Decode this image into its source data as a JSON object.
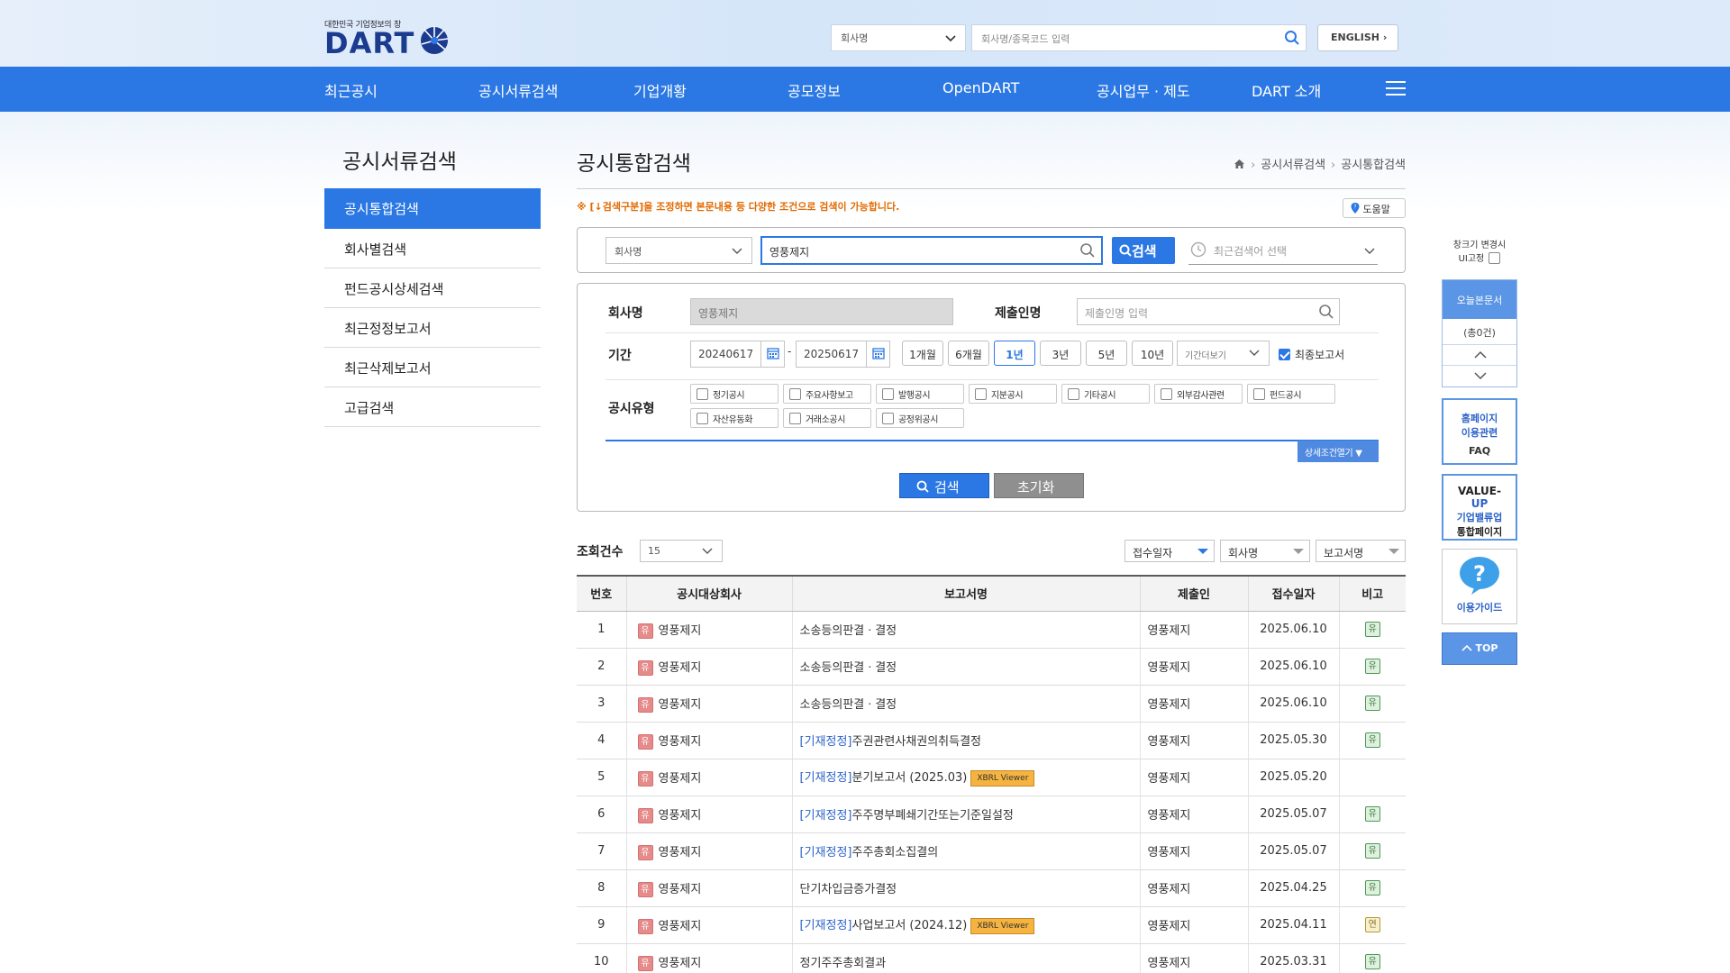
{
  "header": {
    "logo_subtitle": "대한민국 기업정보의 창",
    "logo_text": "DART",
    "search_type": "회사명",
    "search_placeholder": "회사명/종목코드 입력",
    "english_label": "ENGLISH"
  },
  "gnb": {
    "items": [
      "최근공시",
      "공시서류검색",
      "기업개황",
      "공모정보",
      "OpenDART",
      "공시업무 · 제도",
      "DART 소개"
    ]
  },
  "sidebar": {
    "title": "공시서류검색",
    "items": [
      {
        "label": "공시통합검색",
        "active": true
      },
      {
        "label": "회사별검색"
      },
      {
        "label": "펀드공시상세검색"
      },
      {
        "label": "최근정정보고서"
      },
      {
        "label": "최근삭제보고서"
      },
      {
        "label": "고급검색"
      }
    ]
  },
  "main": {
    "title": "공시통합검색",
    "breadcrumb": [
      "공시서류검색",
      "공시통합검색"
    ],
    "notice": "※ [↓검색구분]을 조정하면 본문내용 등 다양한 조건으로 검색이 가능합니다.",
    "help_label": "도움말"
  },
  "searchbar": {
    "type": "회사명",
    "query": "영풍제지",
    "button": "검색",
    "recent_placeholder": "최근검색어 선택"
  },
  "filters": {
    "company_label": "회사명",
    "company_value": "영풍제지",
    "submitter_label": "제출인명",
    "submitter_placeholder": "제출인명 입력",
    "period_label": "기간",
    "date_from": "20240617",
    "date_dash": "-",
    "date_to": "20250617",
    "periods": [
      "1개월",
      "6개월",
      "1년",
      "3년",
      "5년",
      "10년"
    ],
    "active_period": "1년",
    "period_more": "기간더보기",
    "final_report_label": "최종보고서",
    "final_report_checked": true,
    "type_label": "공시유형",
    "types": [
      "정기공시",
      "주요사항보고",
      "발행공시",
      "지분공시",
      "기타공시",
      "외부감사관련",
      "펀드공시",
      "자산유동화",
      "거래소공시",
      "공정위공시"
    ],
    "detail_button": "상세조건열기 ▼",
    "search_button": "검색",
    "reset_button": "초기화"
  },
  "results": {
    "count_label": "조회건수",
    "count_value": "15",
    "sort_options": [
      "접수일자",
      "회사명",
      "보고서명"
    ],
    "columns": [
      "번호",
      "공시대상회사",
      "보고서명",
      "제출인",
      "접수일자",
      "비고"
    ],
    "correction_tag": "[기재정정]",
    "xbrl_label": "XBRL Viewer",
    "market_badge": "유",
    "rows": [
      {
        "no": "1",
        "corp": "영풍제지",
        "report": "소송등의판결ㆍ결정",
        "corrected": false,
        "xbrl": false,
        "submitter": "영풍제지",
        "date": "2025.06.10",
        "note": "유"
      },
      {
        "no": "2",
        "corp": "영풍제지",
        "report": "소송등의판결ㆍ결정",
        "corrected": false,
        "xbrl": false,
        "submitter": "영풍제지",
        "date": "2025.06.10",
        "note": "유"
      },
      {
        "no": "3",
        "corp": "영풍제지",
        "report": "소송등의판결ㆍ결정",
        "corrected": false,
        "xbrl": false,
        "submitter": "영풍제지",
        "date": "2025.06.10",
        "note": "유"
      },
      {
        "no": "4",
        "corp": "영풍제지",
        "report": "주권관련사채권의취득결정",
        "corrected": true,
        "xbrl": false,
        "submitter": "영풍제지",
        "date": "2025.05.30",
        "note": "유"
      },
      {
        "no": "5",
        "corp": "영풍제지",
        "report": "분기보고서 (2025.03)",
        "corrected": true,
        "xbrl": true,
        "submitter": "영풍제지",
        "date": "2025.05.20",
        "note": ""
      },
      {
        "no": "6",
        "corp": "영풍제지",
        "report": "주주명부폐쇄기간또는기준일설정",
        "corrected": true,
        "xbrl": false,
        "submitter": "영풍제지",
        "date": "2025.05.07",
        "note": "유"
      },
      {
        "no": "7",
        "corp": "영풍제지",
        "report": "주주총회소집결의",
        "corrected": true,
        "xbrl": false,
        "submitter": "영풍제지",
        "date": "2025.05.07",
        "note": "유"
      },
      {
        "no": "8",
        "corp": "영풍제지",
        "report": "단기차입금증가결정",
        "corrected": false,
        "xbrl": false,
        "submitter": "영풍제지",
        "date": "2025.04.25",
        "note": "유"
      },
      {
        "no": "9",
        "corp": "영풍제지",
        "report": "사업보고서 (2024.12)",
        "corrected": true,
        "xbrl": true,
        "submitter": "영풍제지",
        "date": "2025.04.11",
        "note": "연"
      },
      {
        "no": "10",
        "corp": "영풍제지",
        "report": "정기주주총회결과",
        "corrected": false,
        "xbrl": false,
        "submitter": "영풍제지",
        "date": "2025.03.31",
        "note": "유"
      }
    ]
  },
  "quick": {
    "zoom_line1": "창크기 변경시",
    "zoom_line2": "UI고정",
    "today_title": "오늘본문서",
    "today_count": "(총0건)",
    "faq_line1": "홈페이지",
    "faq_line2": "이용관련",
    "faq_line3": "FAQ",
    "value_line1": "VALUE-",
    "value_line2": "UP",
    "value_line3": "기업밸류업",
    "value_line4": "통합페이지",
    "guide_label": "이용가이드",
    "top_label": "TOP"
  }
}
